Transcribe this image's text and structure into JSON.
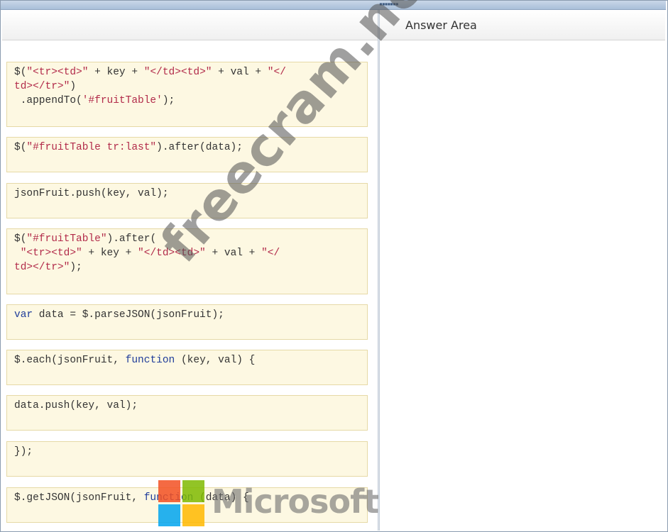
{
  "answer_area": {
    "title": "Answer Area"
  },
  "code_tiles": [
    {
      "lines": [
        [
          {
            "t": "$(",
            "c": "p"
          },
          {
            "t": "\"<tr><td>\"",
            "c": "s"
          },
          {
            "t": " + key + ",
            "c": "p"
          },
          {
            "t": "\"</td><td>\"",
            "c": "s"
          },
          {
            "t": " + val + ",
            "c": "p"
          },
          {
            "t": "\"</",
            "c": "s"
          }
        ],
        [
          {
            "t": "td></tr>\"",
            "c": "s"
          },
          {
            "t": ")",
            "c": "p"
          }
        ],
        [
          {
            "t": " .appendTo(",
            "c": "p"
          },
          {
            "t": "'#fruitTable'",
            "c": "s"
          },
          {
            "t": ");",
            "c": "p"
          }
        ]
      ]
    },
    {
      "lines": [
        [
          {
            "t": "$(",
            "c": "p"
          },
          {
            "t": "\"#fruitTable tr:last\"",
            "c": "s"
          },
          {
            "t": ").after(data);",
            "c": "p"
          }
        ]
      ]
    },
    {
      "lines": [
        [
          {
            "t": "jsonFruit.push(key, val);",
            "c": "p"
          }
        ]
      ]
    },
    {
      "lines": [
        [
          {
            "t": "$(",
            "c": "p"
          },
          {
            "t": "\"#fruitTable\"",
            "c": "s"
          },
          {
            "t": ").after(",
            "c": "p"
          }
        ],
        [
          {
            "t": " ",
            "c": "p"
          },
          {
            "t": "\"<tr><td>\"",
            "c": "s"
          },
          {
            "t": " + key + ",
            "c": "p"
          },
          {
            "t": "\"</td><td>\"",
            "c": "s"
          },
          {
            "t": " + val + ",
            "c": "p"
          },
          {
            "t": "\"</",
            "c": "s"
          }
        ],
        [
          {
            "t": "td></tr>\"",
            "c": "s"
          },
          {
            "t": ");",
            "c": "p"
          }
        ]
      ]
    },
    {
      "lines": [
        [
          {
            "t": "var",
            "c": "k"
          },
          {
            "t": " data = $.parseJSON(jsonFruit);",
            "c": "p"
          }
        ]
      ]
    },
    {
      "lines": [
        [
          {
            "t": "$.each(jsonFruit, ",
            "c": "p"
          },
          {
            "t": "function",
            "c": "k"
          },
          {
            "t": " (key, val) {",
            "c": "p"
          }
        ]
      ]
    },
    {
      "lines": [
        [
          {
            "t": "data.push(key, val);",
            "c": "p"
          }
        ]
      ]
    },
    {
      "lines": [
        [
          {
            "t": "});",
            "c": "p"
          }
        ]
      ]
    },
    {
      "lines": [
        [
          {
            "t": "$.getJSON(jsonFruit, ",
            "c": "p"
          },
          {
            "t": "function",
            "c": "k"
          },
          {
            "t": " (data) {",
            "c": "p"
          }
        ]
      ]
    }
  ],
  "watermark": {
    "text": "freecram.net"
  },
  "logo": {
    "wordmark": "Microsoft",
    "colors": [
      "#f25022",
      "#7fba00",
      "#00a4ef",
      "#ffb900"
    ]
  },
  "colors": {
    "keyword": "#1f3c9a",
    "string": "#b22b4a",
    "code": "#333333",
    "tile_bg": "#fdf8e2",
    "tile_border": "#e6d9a6"
  }
}
